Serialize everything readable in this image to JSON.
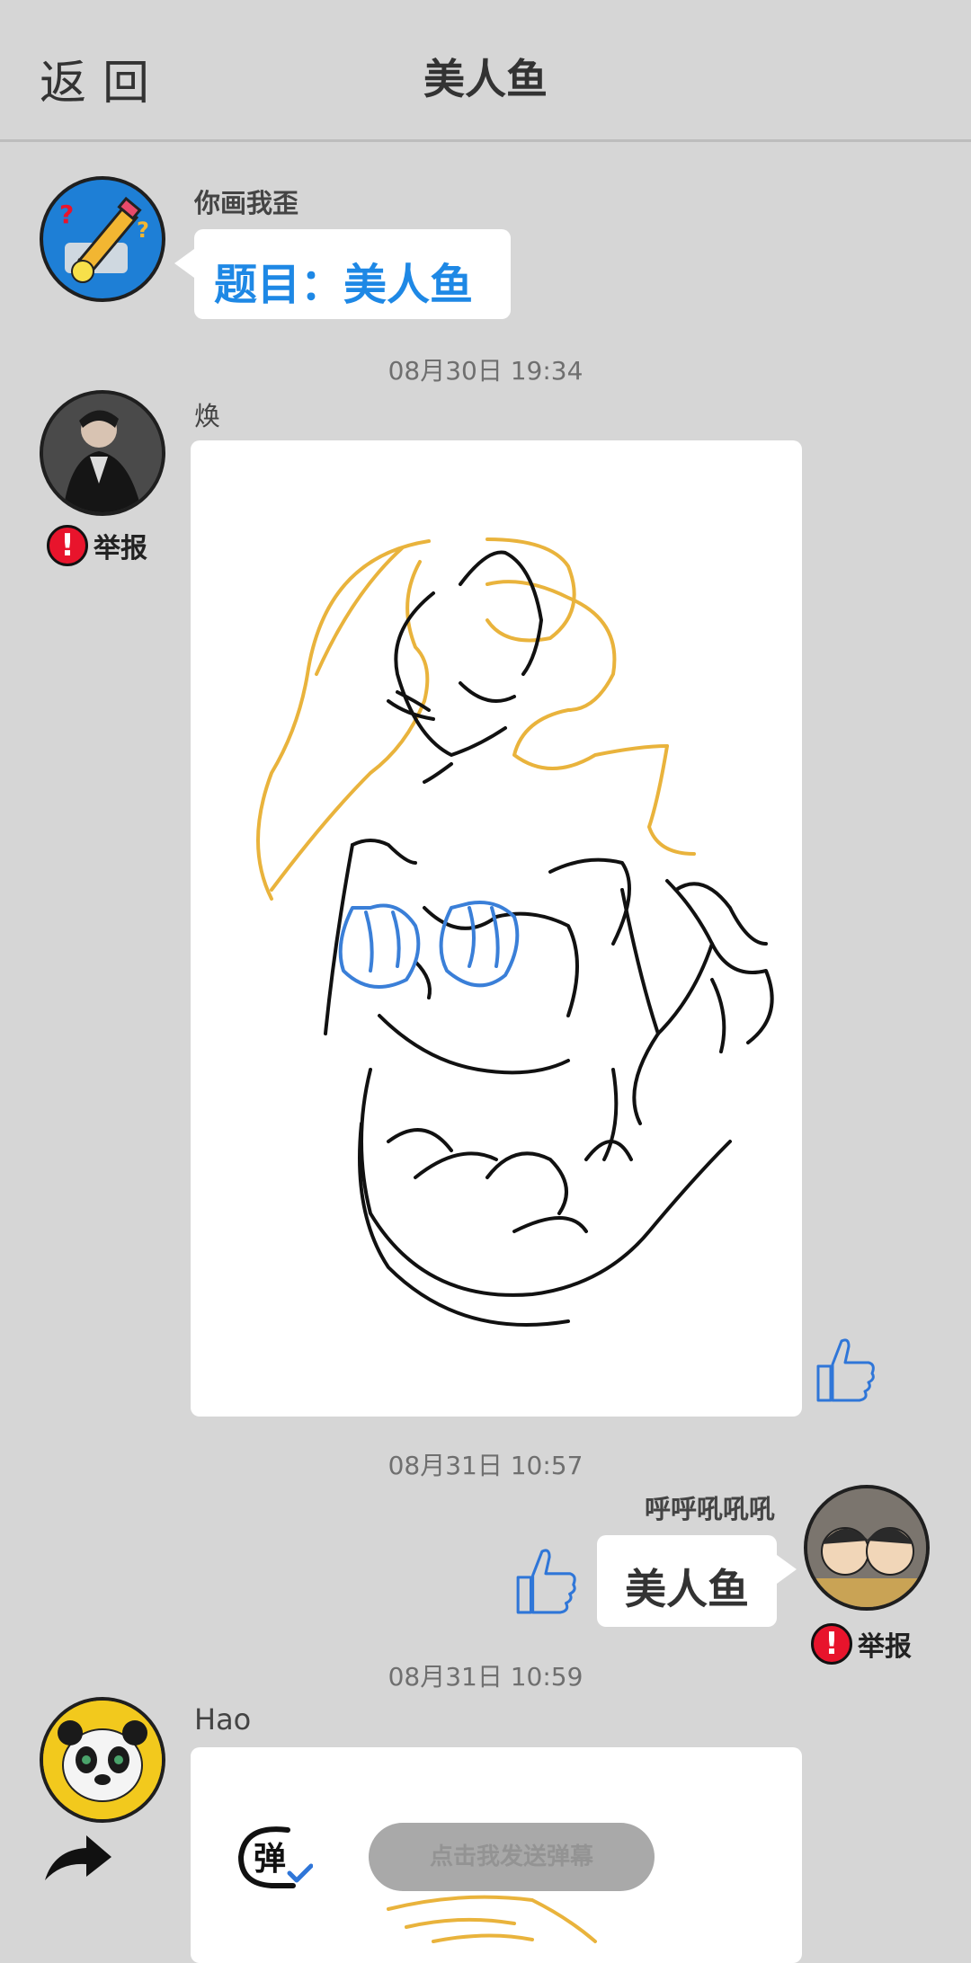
{
  "header": {
    "back_label": "返回",
    "title": "美人鱼"
  },
  "messages": [
    {
      "sender": "你画我歪",
      "text": "题目：美人鱼"
    },
    {
      "time": "08月30日 19:34",
      "sender": "焕",
      "report_label": "举报"
    },
    {
      "time": "08月31日 10:57",
      "sender": "呼呼吼吼吼",
      "text": "美人鱼",
      "report_label": "举报"
    },
    {
      "time": "08月31日 10:59",
      "sender": "Hao"
    }
  ],
  "danmu": {
    "placeholder": "点击我发送弹幕",
    "icon_char": "弹"
  },
  "icons": [
    "pencil-avatar-icon",
    "exclamation-icon",
    "thumbs-up-icon",
    "share-arrow-icon",
    "danmu-icon"
  ],
  "colors": {
    "topic_blue": "#1e88e5",
    "drawing_yellow": "#e9b33c",
    "drawing_blue": "#3a7fd8",
    "report_red": "#e8142c"
  }
}
